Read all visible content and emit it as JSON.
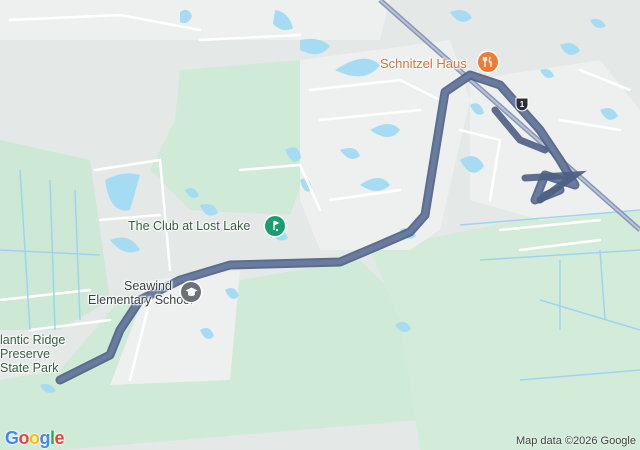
{
  "map": {
    "places": {
      "club": "The Club at Lost Lake",
      "school_line1": "Seawind",
      "school_line2": "Elementary School",
      "park_line1": "lantic Ridge",
      "park_line2": "Preserve",
      "park_line3": "State Park",
      "restaurant": "Schnitzel Haus"
    },
    "highway_shield": "1",
    "logo": "Google",
    "attribution": "Map data ©2026 Google",
    "icons": {
      "restaurant": "fork-knife-icon",
      "golf": "golf-icon",
      "school": "graduation-cap-icon",
      "highway": "us-highway-shield-icon"
    },
    "colors": {
      "route": "#5c6b8e",
      "park_green": "#cfead6",
      "water": "#9fd9f2",
      "road_white": "#ffffff",
      "food_orange": "#ef7b35",
      "golf_green": "#1a9e6e",
      "school_gray": "#6b7178"
    }
  }
}
